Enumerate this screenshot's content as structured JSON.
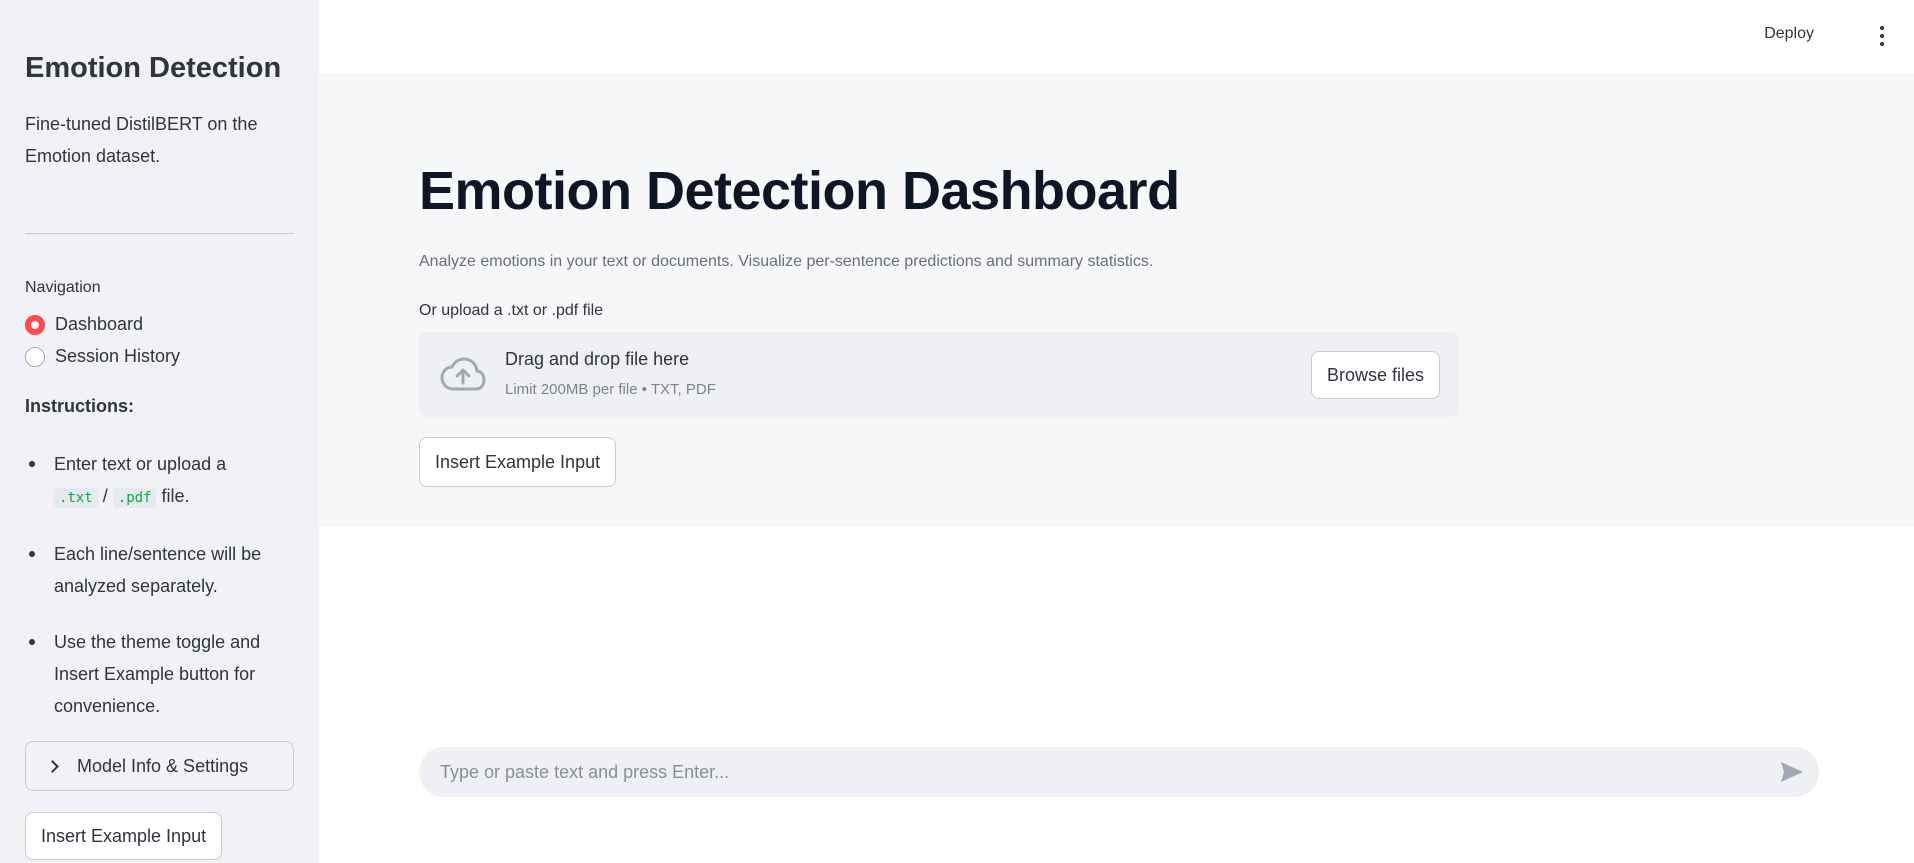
{
  "sidebar": {
    "title": "Emotion Detection",
    "description": "Fine-tuned DistilBERT on the Emotion dataset.",
    "navigation_label": "Navigation",
    "nav_options": [
      {
        "label": "Dashboard",
        "selected": true
      },
      {
        "label": "Session History",
        "selected": false
      }
    ],
    "instructions_title": "Instructions:",
    "instructions": {
      "item1_pre": "Enter text or upload a",
      "item1_code1": ".txt",
      "item1_sep": "/",
      "item1_code2": ".pdf",
      "item1_post": "file.",
      "item2": "Each line/sentence will be analyzed separately.",
      "item3": "Use the theme toggle and Insert Example button for convenience."
    },
    "expander_label": "Model Info & Settings",
    "insert_example_label": "Insert Example Input"
  },
  "header": {
    "deploy_label": "Deploy",
    "menu_icon": "kebab-menu-icon"
  },
  "main": {
    "title": "Emotion Detection Dashboard",
    "subtitle": "Analyze emotions in your text or documents. Visualize per-sentence predictions and summary statistics.",
    "upload_label": "Or upload a .txt or .pdf file",
    "dropzone": {
      "icon": "cloud-upload-icon",
      "main_text": "Drag and drop file here",
      "sub_text": "Limit 200MB per file • TXT, PDF",
      "browse_label": "Browse files"
    },
    "insert_example_label": "Insert Example Input"
  },
  "chat": {
    "placeholder": "Type or paste text and press Enter...",
    "value": "",
    "send_icon": "send-icon"
  },
  "colors": {
    "accent": "#ff4b4b",
    "sidebar_bg": "#f0f2f6",
    "main_bg": "#f6f7f9",
    "title": "#0e1525",
    "code": "#09ab3b"
  }
}
